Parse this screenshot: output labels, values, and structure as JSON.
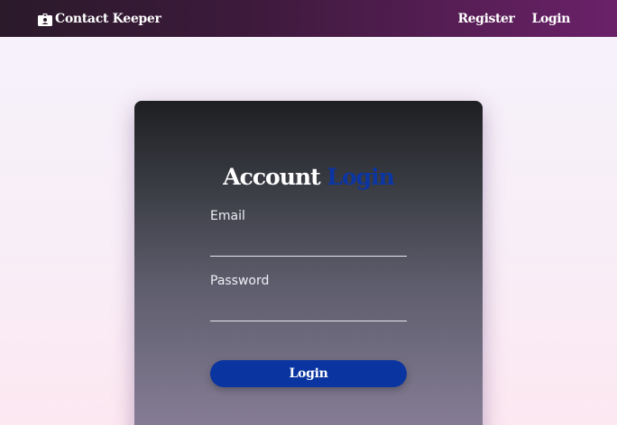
{
  "navbar": {
    "brand_icon": "id-badge-icon",
    "brand_title": "Contact Keeper",
    "links": [
      {
        "label": "Register"
      },
      {
        "label": "Login"
      }
    ]
  },
  "login_card": {
    "title_part1": "Account",
    "title_part2": "Login",
    "email_label": "Email",
    "email_value": "",
    "password_label": "Password",
    "password_value": "",
    "submit_label": "Login"
  },
  "colors": {
    "navbar_start": "#2a1a2a",
    "navbar_end": "#6a2168",
    "accent_blue": "#0a35a0",
    "card_top": "#1d1f22",
    "card_bottom": "#8a8099"
  }
}
